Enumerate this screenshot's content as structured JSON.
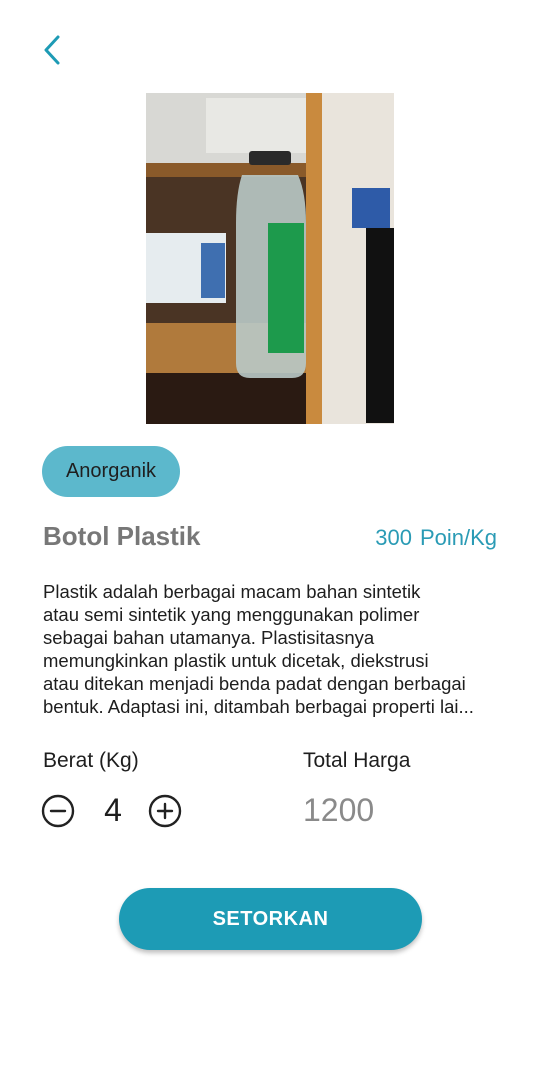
{
  "colors": {
    "accent": "#1d9bb5",
    "chip": "#5cb8cc",
    "title": "#777777",
    "price": "#2a9bb5",
    "muted_value": "#8a8a8a"
  },
  "header": {
    "back_icon": "chevron-left-icon"
  },
  "product": {
    "image_icon": "product-photo",
    "category": "Anorganik",
    "title": "Botol Plastik",
    "price_points": "300",
    "price_unit": "Poin/Kg",
    "description_lines": [
      "Plastik adalah berbagai macam bahan sintetik",
      "atau semi sintetik yang menggunakan polimer",
      "sebagai bahan utamanya. Plastisitasnya",
      "memungkinkan plastik untuk dicetak, diekstrusi",
      "atau ditekan menjadi benda padat dengan berbagai",
      "bentuk. Adaptasi ini, ditambah berbagai properti lai..."
    ]
  },
  "form": {
    "weight_label": "Berat (Kg)",
    "weight_value": "4",
    "minus_icon": "minus-circle-icon",
    "plus_icon": "plus-circle-icon",
    "total_label": "Total Harga",
    "total_value": "1200"
  },
  "actions": {
    "submit_label": "SETORKAN"
  }
}
